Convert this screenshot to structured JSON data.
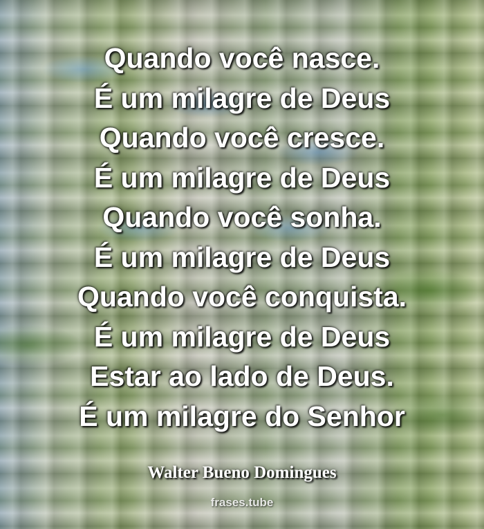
{
  "poem": {
    "lines": [
      "Quando você nasce.",
      "É um milagre de Deus",
      "Quando você cresce.",
      "É um milagre de Deus",
      "Quando você sonha.",
      "É um milagre de Deus",
      "Quando você conquista.",
      "É um milagre de Deus",
      "Estar ao lado de Deus.",
      "É um milagre do Senhor"
    ]
  },
  "author": "Walter Bueno Domingues",
  "watermark": "frases.tube"
}
